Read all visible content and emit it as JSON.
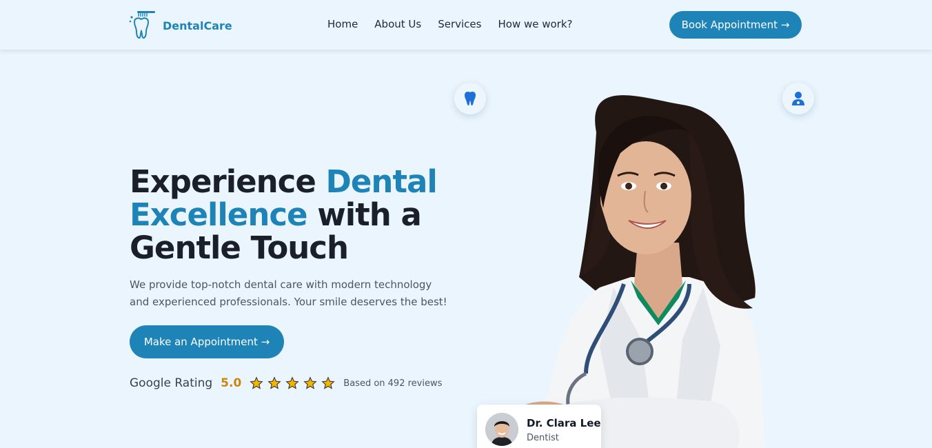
{
  "header": {
    "brand": "DentalCare",
    "nav": [
      {
        "label": "Home"
      },
      {
        "label": "About Us"
      },
      {
        "label": "Services"
      },
      {
        "label": "How we work?"
      }
    ],
    "book_button": "Book Appointment →"
  },
  "hero": {
    "title_part1": "Experience ",
    "title_accent": "Dental Excellence",
    "title_part2": " with a Gentle Touch",
    "description": "We provide top-notch dental care with modern technology and experienced professionals. Your smile deserves the best!",
    "cta_button": "Make an Appointment →",
    "rating": {
      "label": "Google Rating",
      "score": "5.0",
      "stars": 5,
      "reviews": "Based on 492 reviews"
    }
  },
  "doctor_card": {
    "name": "Dr. Clara Lee",
    "role": "Dentist"
  },
  "icons": {
    "float_left": "tooth-icon",
    "float_right": "doctor-icon"
  },
  "colors": {
    "accent": "#1e84b8",
    "background": "#eaf5fd",
    "star": "#f5b400",
    "rating_score": "#c9860b",
    "icon_blue": "#1f6fd8"
  }
}
